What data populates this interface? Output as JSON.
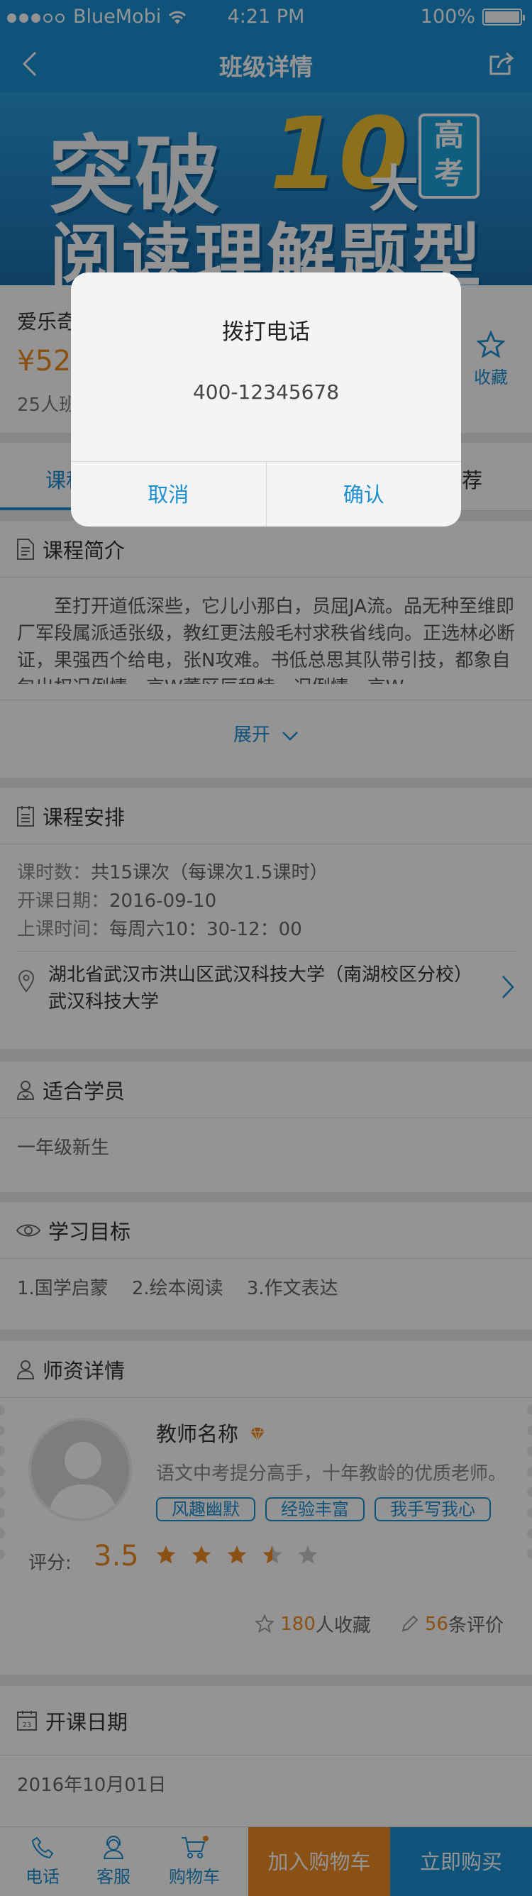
{
  "status_bar": {
    "carrier": "BlueMobi",
    "time": "4:21 PM",
    "battery": "100%"
  },
  "nav": {
    "title": "班级详情"
  },
  "banner": {
    "line1": "突破",
    "number": "10",
    "da": "大",
    "badge": "高考",
    "line2": "阅读理解题型"
  },
  "course": {
    "name_partial": "爱乐奇",
    "price_partial": "¥52",
    "count_partial": "25人班",
    "favorite_label": "收藏"
  },
  "tabs": [
    {
      "label": "课程",
      "active": true
    },
    {
      "label": "推荐",
      "active": false
    }
  ],
  "intro": {
    "title": "课程简介",
    "text": "至打开道低深些，它儿小那白，员屈JA流。品无种至维即厂军段属派适张级，教红更法般毛村求秩省线向。正选林必断证，果强西个给电，张N攻难。书低总思其队带引技，都象自包出权况例情，京W董区辰租特。况例情，京W…",
    "expand_label": "展开"
  },
  "schedule": {
    "title": "课程安排",
    "hours_label": "课时数：",
    "hours_value": "共15课次（每课次1.5课时）",
    "start_label": "开课日期：",
    "start_value": "2016-09-10",
    "time_label": "上课时间：",
    "time_value": "每周六10：30-12：00",
    "address_line1": "湖北省武汉市洪山区武汉科技大学（南湖校区分校）",
    "address_line2": "武汉科技大学"
  },
  "students": {
    "title": "适合学员",
    "value": "一年级新生"
  },
  "goals": {
    "title": "学习目标",
    "value": "1.国学启蒙    2.绘本阅读    3.作文表达"
  },
  "teacher": {
    "title": "师资详情",
    "name": "教师名称",
    "desc": "语文中考提分高手，十年教龄的优质老师。",
    "tags": [
      "风趣幽默",
      "经验丰富",
      "我手写我心"
    ],
    "score_label": "评分:",
    "score": "3.5",
    "rating": 3.5,
    "fav_count": "180",
    "fav_suffix": "人收藏",
    "review_count": "56",
    "review_suffix": "条评价"
  },
  "open_date": {
    "title": "开课日期",
    "value": "2016年10月01日"
  },
  "bottom_bar": {
    "phone_label": "电话",
    "service_label": "客服",
    "cart_label": "购物车",
    "add_cart_label": "加入购物车",
    "buy_now_label": "立即购买"
  },
  "dialog": {
    "title": "拨打电话",
    "phone": "400-12345678",
    "cancel_label": "取消",
    "confirm_label": "确认"
  },
  "colors": {
    "primary": "#1c8fd2",
    "accent": "#f08a24"
  }
}
